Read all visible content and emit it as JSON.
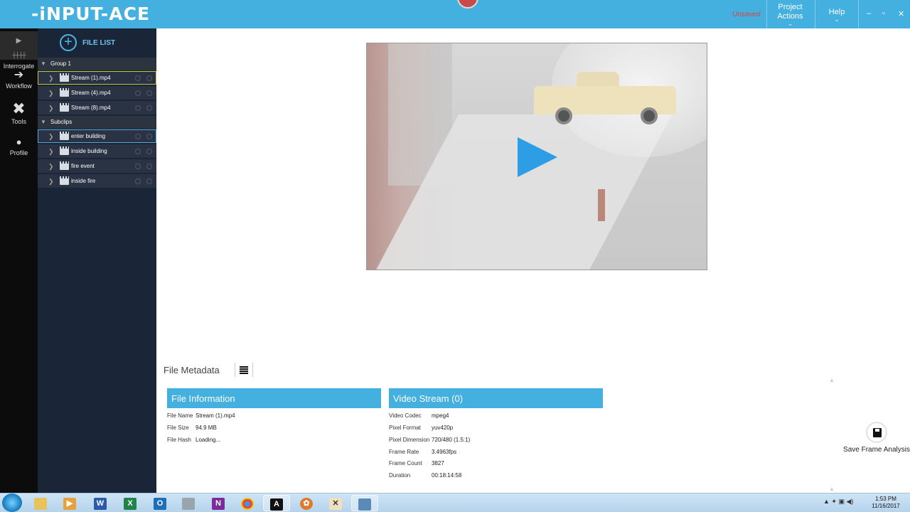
{
  "app": {
    "logo": "-iNPUT-ACE",
    "status": "Unsaved",
    "nav": {
      "project_actions": "Project\nActions",
      "help": "Help"
    },
    "window_controls": [
      "–",
      "▫",
      "✕"
    ]
  },
  "rail": [
    {
      "label": "Interrogate",
      "icon": "play-icon"
    },
    {
      "label": "Workflow",
      "icon": "arrow-right-icon"
    },
    {
      "label": "Tools",
      "icon": "tools-icon"
    },
    {
      "label": "Profile",
      "icon": "person-icon"
    }
  ],
  "file_list": {
    "title": "FILE LIST",
    "groups": [
      {
        "label": "Group 1",
        "items": [
          "Stream (1).mp4",
          "Stream (4).mp4",
          "Stream (8).mp4"
        ]
      },
      {
        "label": "Subclips",
        "items": [
          "enter building",
          "inside building",
          "fire event",
          "inside fire"
        ]
      }
    ]
  },
  "metadata": {
    "title": "File Metadata",
    "file_info": {
      "heading": "File Information",
      "rows": [
        {
          "k": "File Name",
          "v": "Stream (1).mp4"
        },
        {
          "k": "File Size",
          "v": "94.9 MB"
        },
        {
          "k": "File Hash",
          "v": "Loading..."
        }
      ]
    },
    "video_stream": {
      "heading": "Video Stream (0)",
      "rows": [
        {
          "k": "Video Codec",
          "v": "mpeg4"
        },
        {
          "k": "Pixel Format",
          "v": "yuv420p"
        },
        {
          "k": "Pixel Dimension",
          "v": "720/480 (1.5:1)"
        },
        {
          "k": "Frame Rate",
          "v": "3.4963fps"
        },
        {
          "k": "Frame Count",
          "v": "3827"
        },
        {
          "k": "Duration",
          "v": "00:18:14:58"
        }
      ]
    }
  },
  "save_frame_label": "Save Frame Analysis",
  "taskbar": {
    "apps": [
      "W",
      "X",
      "O",
      "N",
      "A"
    ],
    "time": "1:53 PM",
    "date": "11/16/2017"
  }
}
